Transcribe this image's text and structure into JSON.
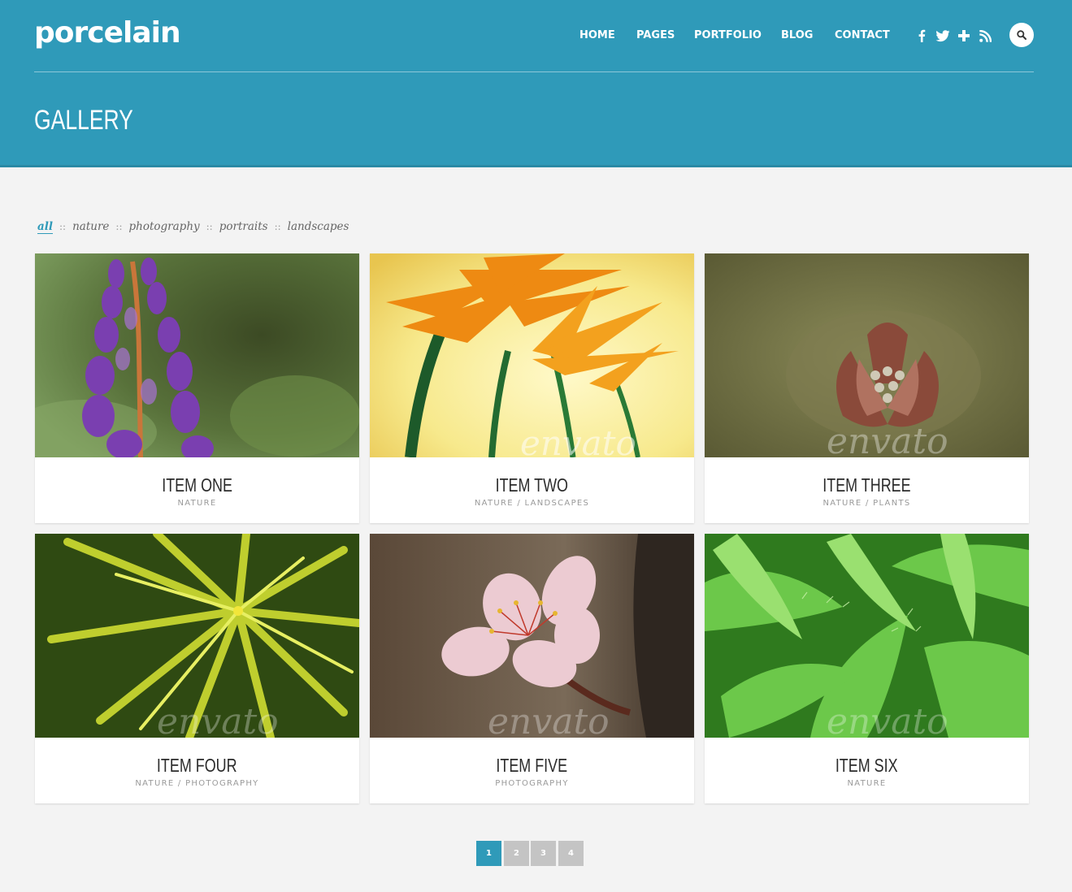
{
  "brand": {
    "logo_text": "porcelain"
  },
  "nav": {
    "items": [
      "HOME",
      "PAGES",
      "PORTFOLIO",
      "BLOG",
      "CONTACT"
    ]
  },
  "social": [
    "facebook-icon",
    "twitter-icon",
    "plus-icon",
    "rss-icon"
  ],
  "header": {
    "page_title": "GALLERY"
  },
  "filters": {
    "items": [
      "all",
      "nature",
      "photography",
      "portraits",
      "landscapes"
    ],
    "active": "all",
    "separator": "::"
  },
  "gallery": {
    "items": [
      {
        "title": "ITEM ONE",
        "categories": "NATURE"
      },
      {
        "title": "ITEM TWO",
        "categories": "NATURE / LANDSCAPES"
      },
      {
        "title": "ITEM THREE",
        "categories": "NATURE / PLANTS"
      },
      {
        "title": "ITEM FOUR",
        "categories": "NATURE / PHOTOGRAPHY"
      },
      {
        "title": "ITEM FIVE",
        "categories": "PHOTOGRAPHY"
      },
      {
        "title": "ITEM SIX",
        "categories": "NATURE"
      }
    ],
    "watermark": "envato"
  },
  "pagination": {
    "pages": [
      "1",
      "2",
      "3",
      "4"
    ],
    "current": "1"
  },
  "colors": {
    "accent": "#2f9ab9",
    "background": "#f3f3f3",
    "pager_inactive": "#c4c4c4"
  }
}
